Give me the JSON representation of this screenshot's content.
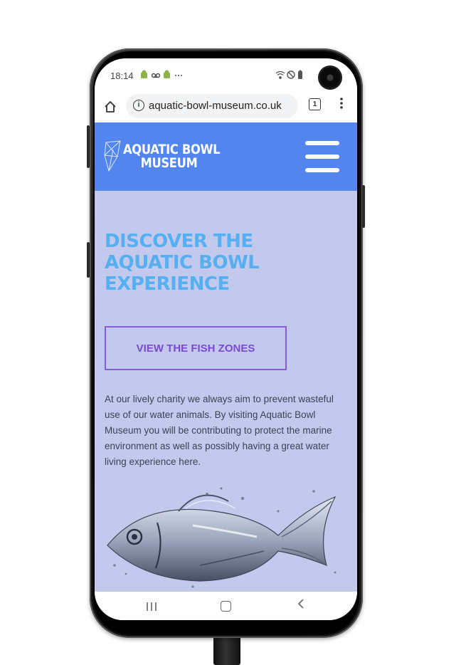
{
  "status_bar": {
    "time": "18:14",
    "notification_icons": [
      "android-icon",
      "voicemail-icon",
      "android-debug-icon",
      "more-dots-icon"
    ],
    "notification_text": "• ∞ • ···",
    "system_icons": [
      "wifi-icon",
      "dnd-icon",
      "battery-icon"
    ]
  },
  "browser": {
    "url": "aquatic-bowl-museum.co.uk",
    "tab_count": "1"
  },
  "site": {
    "logo_line1": "AQUATIC BOWL",
    "logo_line2": "MUSEUM",
    "hero_line1": "DISCOVER THE",
    "hero_line2": "AQUATIC BOWL",
    "hero_line3": "EXPERIENCE",
    "cta_label": "VIEW THE FISH ZONES",
    "intro_text": "At our lively charity we always aim to prevent wasteful use of our water animals. By visiting Aquatic Bowl Museum you will be contributing to protect the marine environment as well as possibly having a great water living experience here."
  },
  "colors": {
    "header_bg": "#5286ee",
    "page_bg": "#c3c9ec",
    "hero_text": "#55aff0",
    "cta_border": "#8a5bd6",
    "cta_text": "#7a4bd0"
  }
}
